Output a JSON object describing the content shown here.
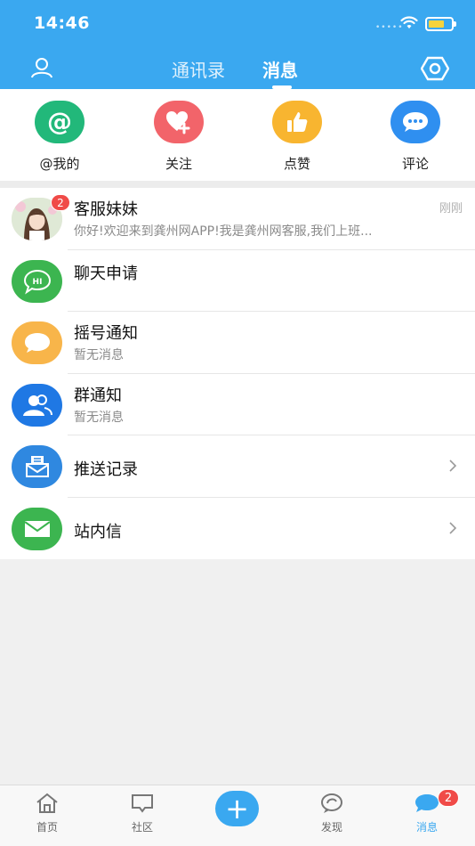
{
  "status_bar": {
    "time": "14:46",
    "signal_dots": "•••••"
  },
  "header": {
    "tabs": [
      {
        "label": "通讯录",
        "active": false
      },
      {
        "label": "消息",
        "active": true
      }
    ]
  },
  "quick_actions": [
    {
      "label": "@我的",
      "icon": "at-icon",
      "color": "#22b87a"
    },
    {
      "label": "关注",
      "icon": "heart-plus-icon",
      "color": "#f2646a"
    },
    {
      "label": "点赞",
      "icon": "thumbs-up-icon",
      "color": "#f8b530"
    },
    {
      "label": "评论",
      "icon": "comment-icon",
      "color": "#2f8ff0"
    }
  ],
  "messages": [
    {
      "title": "客服妹妹",
      "subtitle": "你好!欢迎来到龚州网APP!我是龚州网客服,我们上班...",
      "time": "刚刚",
      "badge": "2",
      "icon": "avatar-photo"
    },
    {
      "title": "聊天申请",
      "subtitle": "",
      "icon": "hi-chat-icon",
      "color": "#3cb550",
      "hi_text": "HI"
    },
    {
      "title": "摇号通知",
      "subtitle": "暂无消息",
      "icon": "speech-bubble-icon",
      "color": "#f8b54a"
    },
    {
      "title": "群通知",
      "subtitle": "暂无消息",
      "icon": "group-icon",
      "color": "#1f78e4"
    },
    {
      "title": "推送记录",
      "icon": "inbox-icon",
      "color": "#2f88e0",
      "chevron": true
    },
    {
      "title": "站内信",
      "icon": "envelope-icon",
      "color": "#3cb550",
      "chevron": true
    }
  ],
  "tabbar": {
    "items": [
      {
        "label": "首页",
        "icon": "home-icon",
        "active": false
      },
      {
        "label": "社区",
        "icon": "community-icon",
        "active": false
      },
      {
        "label": "发现",
        "icon": "discover-icon",
        "active": false
      },
      {
        "label": "消息",
        "icon": "message-icon",
        "active": true,
        "badge": "2"
      }
    ],
    "plus_symbol": "+"
  },
  "colors": {
    "brand": "#3aa8f0",
    "badge": "#f04b48"
  }
}
